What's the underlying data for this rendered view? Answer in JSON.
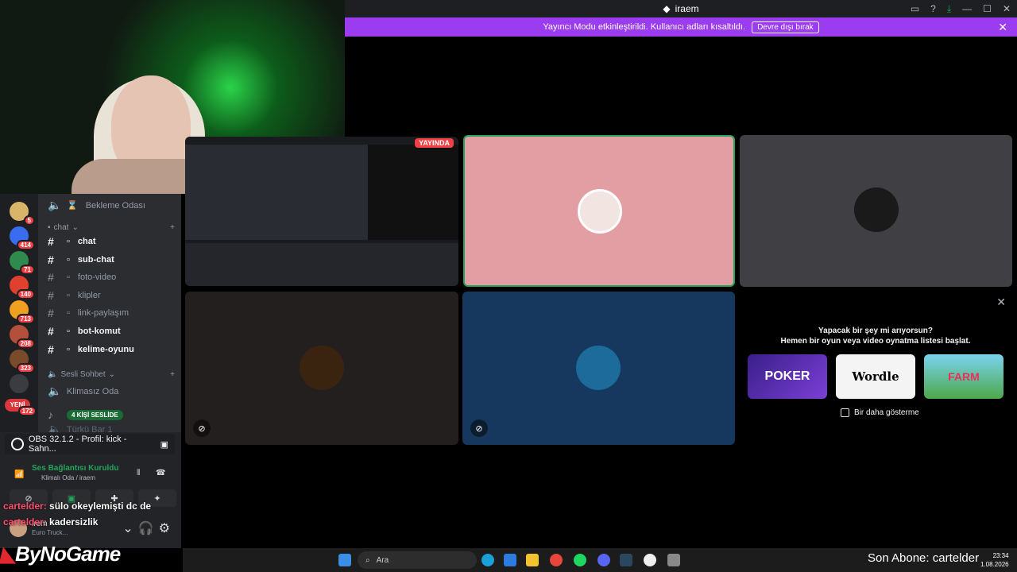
{
  "titlebar": {
    "app_title": "iraem",
    "icons": [
      "inbox-icon",
      "help-icon",
      "download-icon",
      "minimize-icon",
      "maximize-icon",
      "close-icon"
    ]
  },
  "banner": {
    "message": "Yayıncı Modu etkinleştirildi. Kullanıcı adları kısaltıldı.",
    "button": "Devre dışı bırak"
  },
  "sidebar": {
    "servers": [
      {
        "badge": "5",
        "color": "#d9b56a"
      },
      {
        "badge": "414",
        "color": "#3a6cf0"
      },
      {
        "badge": "71",
        "color": "#2f8a4e"
      },
      {
        "badge": "140",
        "color": "#e0402e"
      },
      {
        "badge": "713",
        "color": "#f0a020"
      },
      {
        "badge": "208",
        "color": "#b34f3a"
      },
      {
        "badge": "323",
        "color": "#7a4b2a"
      },
      {
        "badge": "",
        "color": "#3a3c41"
      },
      {
        "badge": "172",
        "color": "#da373c",
        "label": "YENİ"
      }
    ],
    "channels": {
      "waiting_room": "Bekleme Odası",
      "text_category": "chat",
      "text_channels": [
        {
          "name": "chat",
          "bold": true
        },
        {
          "name": "sub-chat",
          "bold": true
        },
        {
          "name": "foto-video",
          "bold": false
        },
        {
          "name": "klipler",
          "bold": false
        },
        {
          "name": "link-paylaşım",
          "bold": false
        },
        {
          "name": "bot-komut",
          "bold": true
        },
        {
          "name": "kelime-oyunu",
          "bold": true
        }
      ],
      "voice_category": "Sesli Sohbet",
      "voice_channel": "Klimasız Oda",
      "voice_pill": "4 KİŞİ SESLİDE",
      "partial_channel": "Türkü Bar 1"
    },
    "obs_stream": "OBS 32.1.2 - Profil: kick - Sahn...",
    "voice_status": "Ses Bağlantısı Kuruldu",
    "voice_location": "Klimalı Oda / iraem",
    "user": {
      "name": "irem",
      "activity": "Euro Truck..."
    }
  },
  "chat_overlay": [
    {
      "user": "cartelder:",
      "message": "sülo okeylemişti dc de"
    },
    {
      "user": "cartelder:",
      "message": "kadersizlik"
    }
  ],
  "stream_logo": "ByNoGame",
  "stage": {
    "live_badge": "YAYINDA",
    "tiles": [
      {
        "type": "screen",
        "muted": true
      },
      {
        "type": "user",
        "bg": "#e39ea3",
        "speaking": true
      },
      {
        "type": "user",
        "bg": "#3f3f44"
      },
      {
        "type": "user",
        "bg": "#231f1e",
        "muted": true
      },
      {
        "type": "user",
        "bg": "#16385e",
        "muted": true
      }
    ]
  },
  "activity": {
    "question": "Yapacak bir şey mi arıyorsun?",
    "subtitle": "Hemen bir oyun veya video oynatma listesi başlat.",
    "games": [
      "POKER",
      "Wordle",
      "FARM"
    ],
    "checkbox_label": "Bir daha gösterme"
  },
  "taskbar": {
    "search_placeholder": "Ara",
    "abone_text": "Son Abone: cartelder",
    "time": "23:34",
    "date": "1.08.2026"
  }
}
